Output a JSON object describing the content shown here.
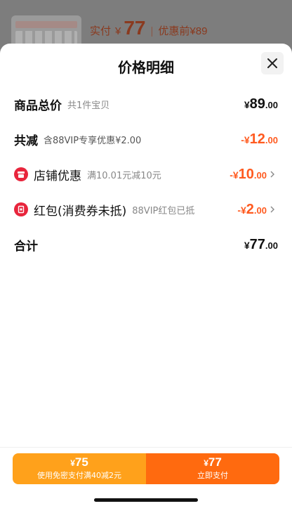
{
  "background": {
    "price_label": "实付",
    "yen": "¥",
    "price": "77",
    "separator": "|",
    "original_label": "优惠前¥89"
  },
  "sheet": {
    "title": "价格明细",
    "rows": [
      {
        "name": "商品总价",
        "sub": "共1件宝贝",
        "yen": "¥",
        "integer": "89",
        "decimal": ".00"
      },
      {
        "name": "共减",
        "sub": "含88VIP专享优惠¥2.00",
        "yen": "-¥",
        "integer": "12",
        "decimal": ".00"
      },
      {
        "name": "店铺优惠",
        "sub": "满10.01元减10元",
        "yen": "-¥",
        "integer": "10",
        "decimal": ".00",
        "icon": "shop-icon"
      },
      {
        "name": "红包(消费券未抵)",
        "sub": "88VIP红包已抵",
        "yen": "-¥",
        "integer": "2",
        "decimal": ".00",
        "icon": "red-packet-icon"
      },
      {
        "name": "合计",
        "sub": "",
        "yen": "¥",
        "integer": "77",
        "decimal": ".00"
      }
    ]
  },
  "bottom": {
    "left": {
      "yen": "¥",
      "amount": "75",
      "label": "使用免密支付满40减2元"
    },
    "right": {
      "yen": "¥",
      "amount": "77",
      "label": "立即支付"
    }
  },
  "colors": {
    "accent_orange": "#ff5a1f",
    "pay_left": "#ffa11b",
    "pay_right": "#ff6a0f",
    "badge_red": "#e8253c"
  }
}
